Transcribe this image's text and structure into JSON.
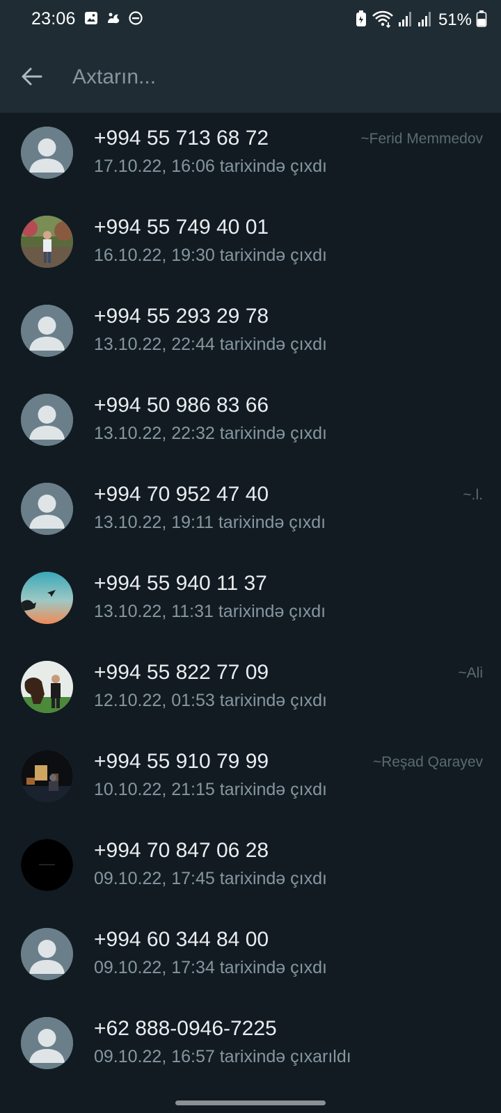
{
  "status_bar": {
    "time": "23:06",
    "battery": "51%",
    "left_icons": [
      "gallery-icon",
      "bixby-routine-icon",
      "dnd-icon"
    ],
    "right_icons": [
      "battery-saver-icon",
      "wifi-icon",
      "signal-1-icon",
      "signal-2-icon",
      "battery-icon"
    ]
  },
  "search": {
    "placeholder": "Axtarın...",
    "value": ""
  },
  "colors": {
    "header_bg": "#1f2c34",
    "list_bg": "#121b22",
    "primary_text": "#e9edef",
    "secondary_text": "#8696a0"
  },
  "participants": [
    {
      "phone": "+994 55 713 68 72",
      "status": "17.10.22, 16:06 tarixində çıxdı",
      "push_name": "~Ferid Memmedov",
      "avatar": "default-avatar"
    },
    {
      "phone": "+994 55 749 40 01",
      "status": "16.10.22, 19:30 tarixində çıxdı",
      "push_name": "",
      "avatar": "photo-person-garden"
    },
    {
      "phone": "+994 55 293 29 78",
      "status": "13.10.22, 22:44 tarixində çıxdı",
      "push_name": "",
      "avatar": "default-avatar"
    },
    {
      "phone": "+994 50 986 83 66",
      "status": "13.10.22, 22:32 tarixində çıxdı",
      "push_name": "",
      "avatar": "default-avatar"
    },
    {
      "phone": "+994 70 952 47 40",
      "status": "13.10.22, 19:11 tarixində çıxdı",
      "push_name": "~.l.",
      "avatar": "default-avatar"
    },
    {
      "phone": "+994 55 940 11 37",
      "status": "13.10.22, 11:31 tarixində çıxdı",
      "push_name": "",
      "avatar": "photo-sunset-paper-plane"
    },
    {
      "phone": "+994 55 822 77 09",
      "status": "12.10.22, 01:53 tarixində çıxdı",
      "push_name": "~Ali",
      "avatar": "photo-man-horse"
    },
    {
      "phone": "+994 55 910 79 99",
      "status": "10.10.22, 21:15 tarixində çıxdı",
      "push_name": "~Reşad Qarayev",
      "avatar": "photo-city-night"
    },
    {
      "phone": "+994 70 847 06 28",
      "status": "09.10.22, 17:45 tarixində çıxdı",
      "push_name": "",
      "avatar": "photo-black"
    },
    {
      "phone": "+994 60 344 84 00",
      "status": "09.10.22, 17:34 tarixində çıxdı",
      "push_name": "",
      "avatar": "default-avatar"
    },
    {
      "phone": "+62 888-0946-7225",
      "status": "09.10.22, 16:57 tarixində çıxarıldı",
      "push_name": "",
      "avatar": "default-avatar"
    }
  ]
}
